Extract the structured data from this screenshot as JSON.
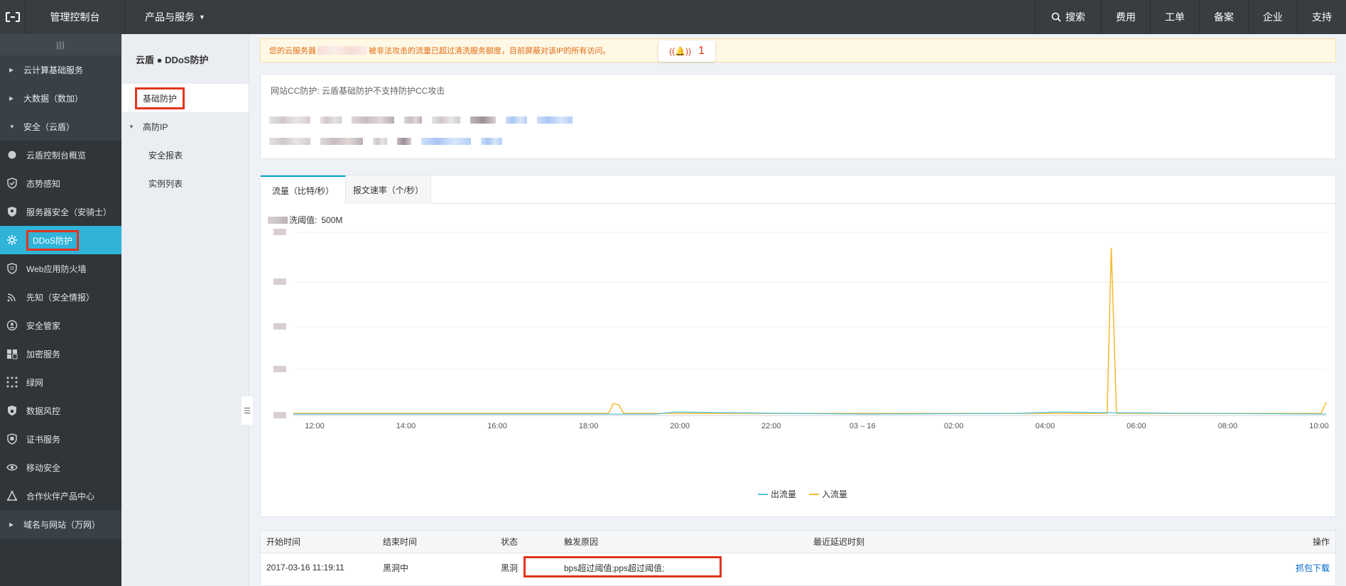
{
  "topbar": {
    "console": "管理控制台",
    "products": "产品与服务",
    "nav": [
      {
        "label": "搜索",
        "name": "nav-search"
      },
      {
        "label": "费用",
        "name": "nav-billing"
      },
      {
        "label": "工单",
        "name": "nav-ticket"
      },
      {
        "label": "备案",
        "name": "nav-icp"
      },
      {
        "label": "企业",
        "name": "nav-enterprise"
      },
      {
        "label": "支持",
        "name": "nav-support"
      }
    ]
  },
  "sidebar": {
    "collapse": "|||",
    "groups": {
      "cloud": "云计算基础服务",
      "bigdata": "大数据（数加）",
      "security": "安全（云盾）",
      "domain": "域名与网站（万网）"
    },
    "items": [
      {
        "label": "云盾控制台概览",
        "icon": "circle-icon"
      },
      {
        "label": "态势感知",
        "icon": "shield-check-icon"
      },
      {
        "label": "服务器安全（安骑士）",
        "icon": "shield-user-icon"
      },
      {
        "label": "DDoS防护",
        "icon": "gear-icon"
      },
      {
        "label": "Web应用防火墙",
        "icon": "firewall-icon"
      },
      {
        "label": "先知（安全情报）",
        "icon": "radar-icon"
      },
      {
        "label": "安全管家",
        "icon": "butler-icon"
      },
      {
        "label": "加密服务",
        "icon": "encrypt-icon"
      },
      {
        "label": "绿网",
        "icon": "green-net-icon"
      },
      {
        "label": "数据风控",
        "icon": "risk-shield-icon"
      },
      {
        "label": "证书服务",
        "icon": "certificate-icon"
      },
      {
        "label": "移动安全",
        "icon": "eye-icon"
      },
      {
        "label": "合作伙伴产品中心",
        "icon": "partner-icon"
      }
    ]
  },
  "subnav": {
    "title": "云盾 ● DDoS防护",
    "basic": "基础防护",
    "high_ip": "高防IP",
    "report": "安全报表",
    "instances": "实例列表"
  },
  "alert": {
    "prefix": "您的云服务器",
    "suffix": "被非法攻击的流量已超过清洗服务额度，目前屏蔽对该IP的所有访问。",
    "count": "1"
  },
  "info": {
    "cc": "网站CC防护:   云盾基础防护不支持防护CC攻击"
  },
  "chart_tabs": {
    "traffic": "流量（比特/秒）",
    "packets": "报文速率（个/秒）"
  },
  "threshold": {
    "label": "洗阈值:",
    "value": "500M"
  },
  "chart_data": {
    "type": "line",
    "x": [
      "12:00",
      "14:00",
      "16:00",
      "18:00",
      "20:00",
      "22:00",
      "03 – 16",
      "02:00",
      "04:00",
      "06:00",
      "08:00",
      "10:00"
    ],
    "series": [
      {
        "name": "出流量",
        "color": "#4fc3e0"
      },
      {
        "name": "入流量",
        "color": "#f5b82e"
      }
    ],
    "grid": true,
    "legend_position": "bottom-center"
  },
  "table": {
    "headers": {
      "start": "开始时间",
      "end": "结束时间",
      "status": "状态",
      "reason": "触发原因",
      "delay": "最近延迟时刻",
      "op": "操作"
    },
    "rows": [
      {
        "start": "2017-03-16 11:19:11",
        "end": "黑洞中",
        "status": "黑洞",
        "reason": "bps超过阈值;pps超过阈值;",
        "op": "抓包下载"
      }
    ]
  }
}
